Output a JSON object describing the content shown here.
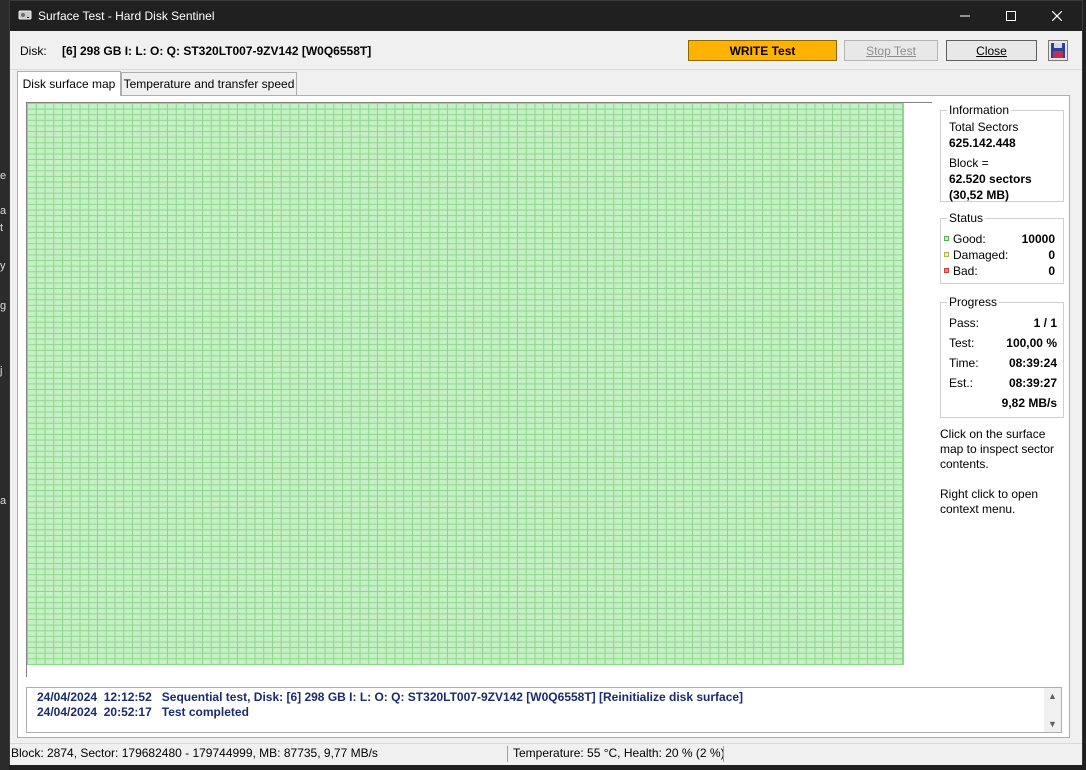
{
  "window": {
    "title": "Surface Test - Hard Disk Sentinel"
  },
  "toolbar": {
    "disk_label": "Disk:",
    "disk_value": "[6] 298 GB I: L: O: Q: ST320LT007-9ZV142 [W0Q6558T]",
    "write_test_label": "WRITE Test",
    "stop_test_label": "Stop Test",
    "close_label": "Close"
  },
  "tabs": [
    {
      "label": "Disk surface map",
      "active": true
    },
    {
      "label": "Temperature and transfer speed",
      "active": false
    }
  ],
  "surface_map": {
    "good_color": "#c4f0c4",
    "grid_color": "#8fd48f"
  },
  "information": {
    "title": "Information",
    "total_sectors_label": "Total Sectors",
    "total_sectors_value": "625.142.448",
    "block_label": "Block =",
    "block_sectors": "62.520 sectors",
    "block_size": "(30,52 MB)"
  },
  "status": {
    "title": "Status",
    "items": [
      {
        "label": "Good:",
        "value": "10000",
        "color": "#8fd48f",
        "border": "#5aa95a"
      },
      {
        "label": "Damaged:",
        "value": "0",
        "color": "#f5f0a0",
        "border": "#b8b050"
      },
      {
        "label": "Bad:",
        "value": "0",
        "color": "#f08080",
        "border": "#c04040"
      }
    ]
  },
  "progress": {
    "title": "Progress",
    "pass_label": "Pass:",
    "pass_value": "1 / 1",
    "test_label": "Test:",
    "test_value": "100,00 %",
    "time_label": "Time:",
    "time_value": "08:39:24",
    "est_label": "Est.:",
    "est_value": "08:39:27",
    "speed_value": "9,82 MB/s"
  },
  "hints": {
    "click": "Click on the surface map to inspect sector contents.",
    "right_click": "Right click to open context menu."
  },
  "log": {
    "lines": [
      "24/04/2024  12:12:52   Sequential test, Disk: [6] 298 GB I: L: O: Q: ST320LT007-9ZV142 [W0Q6558T] [Reinitialize disk surface]",
      "24/04/2024  20:52:17   Test completed"
    ]
  },
  "statusbar": {
    "left": "Block: 2874, Sector: 179682480 - 179744999, MB: 87735, 9,77 MB/s",
    "right": "Temperature: 55  °C,  Health: 20 % (2 %)"
  },
  "background_fragments": [
    "e",
    "a",
    "t",
    "y",
    "g",
    "j",
    "a"
  ]
}
